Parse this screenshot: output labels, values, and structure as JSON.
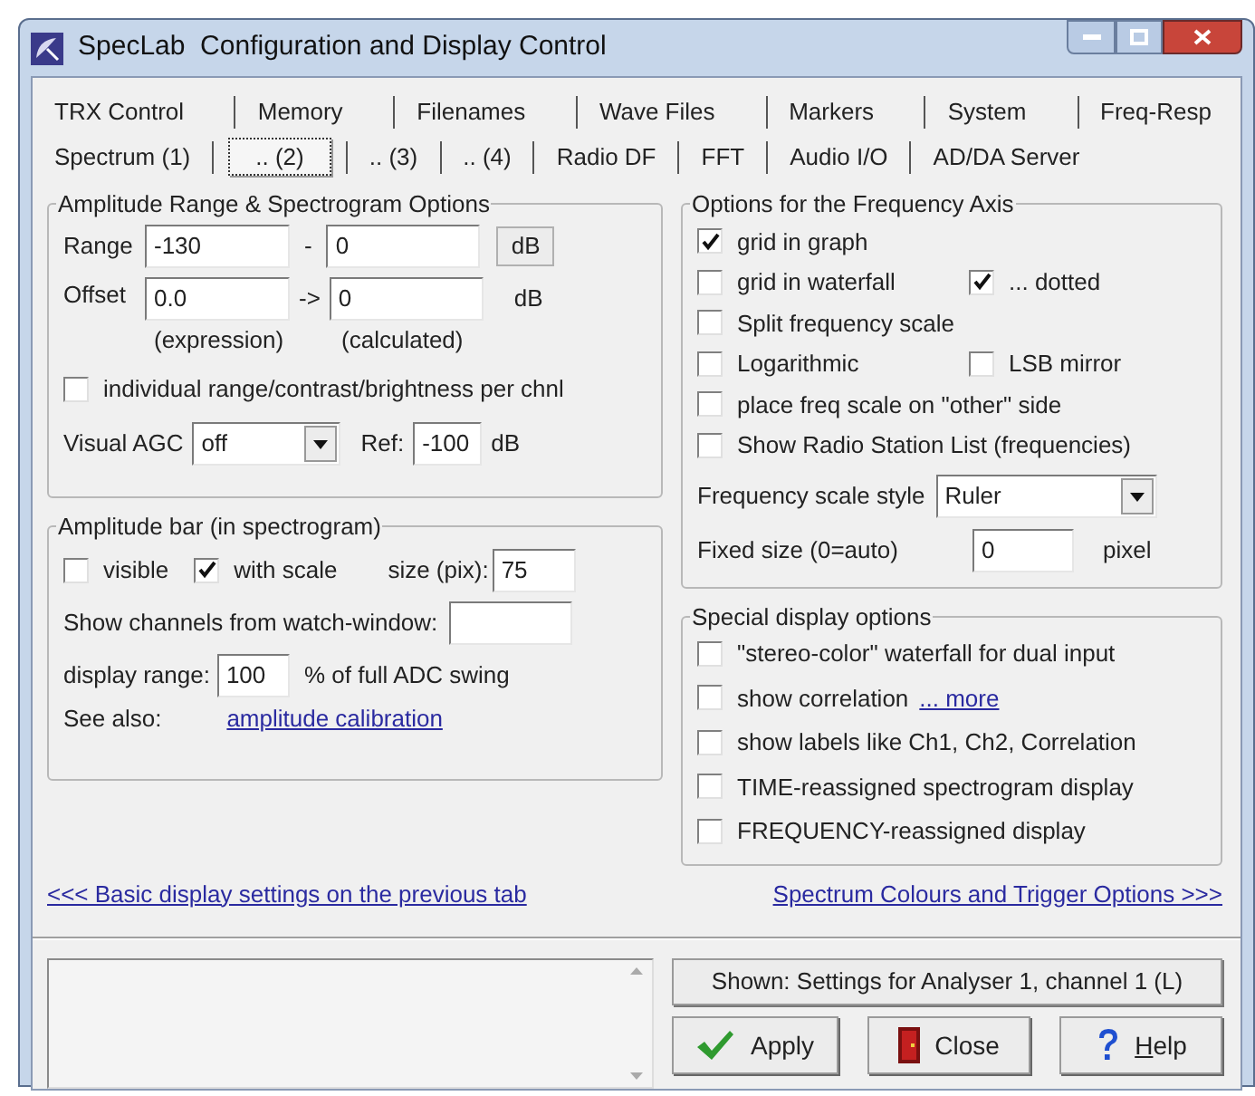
{
  "window": {
    "title": "SpecLab  Configuration and Display Control"
  },
  "tab_rows": [
    [
      {
        "label": "TRX Control",
        "selected": false
      },
      {
        "label": "Memory",
        "selected": false
      },
      {
        "label": "Filenames",
        "selected": false
      },
      {
        "label": "Wave Files",
        "selected": false
      },
      {
        "label": "Markers",
        "selected": false
      },
      {
        "label": "System",
        "selected": false
      },
      {
        "label": "Freq-Resp",
        "selected": false
      }
    ],
    [
      {
        "label": "Spectrum (1)",
        "selected": false
      },
      {
        "label": ".. (2)",
        "selected": true
      },
      {
        "label": ".. (3)",
        "selected": false
      },
      {
        "label": ".. (4)",
        "selected": false
      },
      {
        "label": "Radio DF",
        "selected": false
      },
      {
        "label": "FFT",
        "selected": false
      },
      {
        "label": "Audio I/O",
        "selected": false
      },
      {
        "label": "AD/DA Server",
        "selected": false
      }
    ]
  ],
  "amplitude_range": {
    "title": "Amplitude Range & Spectrogram Options",
    "range_label": "Range",
    "range_from": "-130",
    "range_dash": "-",
    "range_to": "0",
    "db_button": "dB",
    "offset_label": "Offset",
    "offset_value": "0.0",
    "offset_arrow": "->",
    "offset_calculated": "0",
    "offset_unit": "dB",
    "caption_expression": "(expression)",
    "caption_calculated": "(calculated)",
    "individual": {
      "label": "individual range/contrast/brightness per chnl",
      "checked": false
    },
    "agc_label": "Visual AGC",
    "agc_value": "off",
    "ref_label": "Ref:",
    "ref_value": "-100",
    "ref_unit": "dB"
  },
  "amplitude_bar": {
    "title": "Amplitude bar (in spectrogram)",
    "visible": {
      "label": "visible",
      "checked": false
    },
    "with_scale": {
      "label": "with scale",
      "checked": true
    },
    "size_label": "size (pix):",
    "size_value": "75",
    "channels_label": "Show channels from watch-window:",
    "range_label": "display range:",
    "range_value": "100",
    "range_suffix": "% of full ADC swing",
    "see_also_label": "See also:",
    "see_also_link": "amplitude calibration"
  },
  "frequency_axis": {
    "title": "Options for the Frequency Axis",
    "rows": [
      [
        {
          "label": "grid in graph",
          "checked": true
        }
      ],
      [
        {
          "label": "grid in waterfall",
          "checked": false
        },
        {
          "label": "... dotted",
          "checked": true
        }
      ],
      [
        {
          "label": "Split frequency scale",
          "checked": false
        }
      ],
      [
        {
          "label": "Logarithmic",
          "checked": false
        },
        {
          "label": "LSB mirror",
          "checked": false
        }
      ],
      [
        {
          "label": "place freq scale on \"other\" side",
          "checked": false
        }
      ],
      [
        {
          "label": "Show Radio Station List (frequencies)",
          "checked": false
        }
      ]
    ],
    "style_label": "Frequency scale style",
    "style_value": "Ruler",
    "fixed_label": "Fixed size (0=auto)",
    "fixed_value": "0",
    "fixed_unit": "pixel"
  },
  "special_display": {
    "title": "Special display options",
    "items": [
      {
        "label": "\"stereo-color\" waterfall for dual input",
        "checked": false
      },
      {
        "label": "show correlation",
        "checked": false,
        "link": "... more"
      },
      {
        "label": "show labels like Ch1, Ch2, Correlation",
        "checked": false
      },
      {
        "label": "TIME-reassigned spectrogram display",
        "checked": false
      },
      {
        "label": "FREQUENCY-reassigned display",
        "checked": false
      }
    ]
  },
  "links": {
    "previous": "<<< Basic display settings on the previous tab",
    "next": "Spectrum Colours and Trigger Options >>>"
  },
  "footer": {
    "shown_button": "Shown: Settings for Analyser 1, channel 1 (L)",
    "buttons": [
      {
        "kind": "apply",
        "label": "Apply"
      },
      {
        "kind": "close",
        "label": "Close"
      },
      {
        "kind": "help",
        "label": "Help"
      }
    ]
  }
}
